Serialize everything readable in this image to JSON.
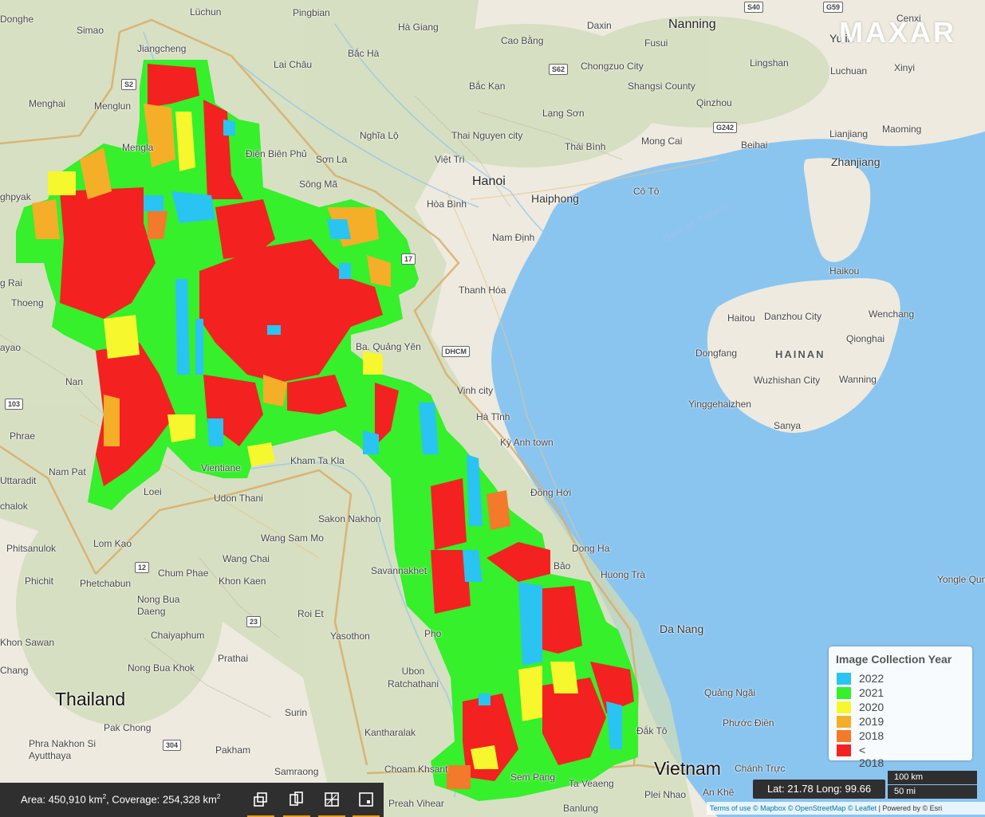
{
  "map": {
    "watermark": "MAXAR",
    "labels": {
      "countries": [
        "Thailand",
        "Vietnam"
      ],
      "regions": [
        "HAINAN"
      ],
      "water": [
        "Gulf of Tonkin"
      ],
      "cities": [
        "Donghe",
        "Simao",
        "Lüchun",
        "Pingbian",
        "Hà Giang",
        "Daxin",
        "Nanning",
        "Cenxi",
        "Jiangcheng",
        "Lai Châu",
        "Bắc Hà",
        "Cao Bằng",
        "Chongzuo City",
        "Fusui",
        "Yulin",
        "Lingshan",
        "Luchuan",
        "Xinyi",
        "Menghai",
        "Menglun",
        "Bắc Kạn",
        "Shangsi County",
        "Qinzhou",
        "Mengla",
        "Nghĩa Lộ",
        "Lạng Sơn",
        "Thai Nguyen city",
        "Thái Bình",
        "Mong Cai",
        "Beihai",
        "Lianjiang",
        "Maoming",
        "Điện Biên Phủ",
        "Sơn La",
        "Việt Trì",
        "Hanoi",
        "Zhanjiang",
        "Sông Mã",
        "Haiphong",
        "Cô Tô",
        "Hòa Bình",
        "Nam Định",
        "Thanh Hóa",
        "Haikou",
        "Haitou",
        "Danzhou City",
        "Wenchang",
        "Qionghai",
        "Dongfang",
        "Ba. Quảng Yên",
        "Wuzhishan City",
        "Wanning",
        "Vinh city",
        "Hà Tĩnh",
        "Yinggehaizhen",
        "Sanya",
        "Kỳ Anh town",
        "Nan",
        "Phrae",
        "Kham Ta Kla",
        "Vientiane",
        "Nam Pat",
        "Loei",
        "Udon Thani",
        "Đồng Hới",
        "Uttaradit",
        "Sakon Nakhon",
        "Wang Sam Mo",
        "Phitsanulok",
        "Lom Kao",
        "Wang Chai",
        "Dong Ha",
        "Chum Phae",
        "Khon Kaen",
        "Savannakhet",
        "Bảo",
        "Huong Trà",
        "Yongle Qun",
        "Phichit",
        "Phetchabun",
        "Nong Bua Daeng",
        "Roi Et",
        "Da Nang",
        "Chaiyaphum",
        "Yasothon",
        "Pho",
        "Khon Sawan",
        "Prathai",
        "Nong Bua Khok",
        "Ubon Ratchathani",
        "Quảng Ngãi",
        "Thailand",
        "Surin",
        "Phước Điền",
        "Pak Chong",
        "Kantharalak",
        "Đắk Tô",
        "Phra Nakhon Si Ayutthaya",
        "Pakham",
        "Samraong",
        "Choam Khsant",
        "Chánh Trực",
        "Preah Vihear",
        "Sem Pang",
        "Ta Veaeng",
        "Plei Nhao",
        "An Khê",
        "Banlung",
        "Nan"
      ],
      "shields": [
        "S40",
        "G59",
        "S2",
        "S62",
        "G242",
        "17",
        "DHCM",
        "103",
        "12",
        "23",
        "304"
      ]
    }
  },
  "legend": {
    "title": "Image Collection Year",
    "items": [
      {
        "label": "2022",
        "color": "#29c4f2"
      },
      {
        "label": "2021",
        "color": "#35f02b"
      },
      {
        "label": "2020",
        "color": "#f7f72d"
      },
      {
        "label": "2019",
        "color": "#f5ae28"
      },
      {
        "label": "2018",
        "color": "#f27a2a"
      },
      {
        "label": "< 2018",
        "color": "#f42121"
      }
    ]
  },
  "stats": {
    "area_label": "Area: 450,910 km",
    "coverage_label": ", Coverage: 254,328 km",
    "unit_sup": "2"
  },
  "tools": [
    {
      "name": "copy-tool",
      "icon": "copy-icon"
    },
    {
      "name": "clone-tool",
      "icon": "duplicate-icon"
    },
    {
      "name": "split-tool",
      "icon": "grid-icon"
    },
    {
      "name": "frame-tool",
      "icon": "frame-icon"
    }
  ],
  "coords": "Lat: 21.78 Long: 99.66",
  "scale": {
    "km": "100 km",
    "mi": "50 mi"
  },
  "attribution": {
    "terms": "Terms of use",
    "mapbox": "© Mapbox",
    "osm": "© OpenStreetMap",
    "leaflet": "© Leaflet",
    "esri": "| Powered by © Esri"
  },
  "colors": {
    "sea": "#8ac5f0",
    "land": "#f0eee5",
    "accent": "#f29a17",
    "bar": "#2f2f2f"
  }
}
